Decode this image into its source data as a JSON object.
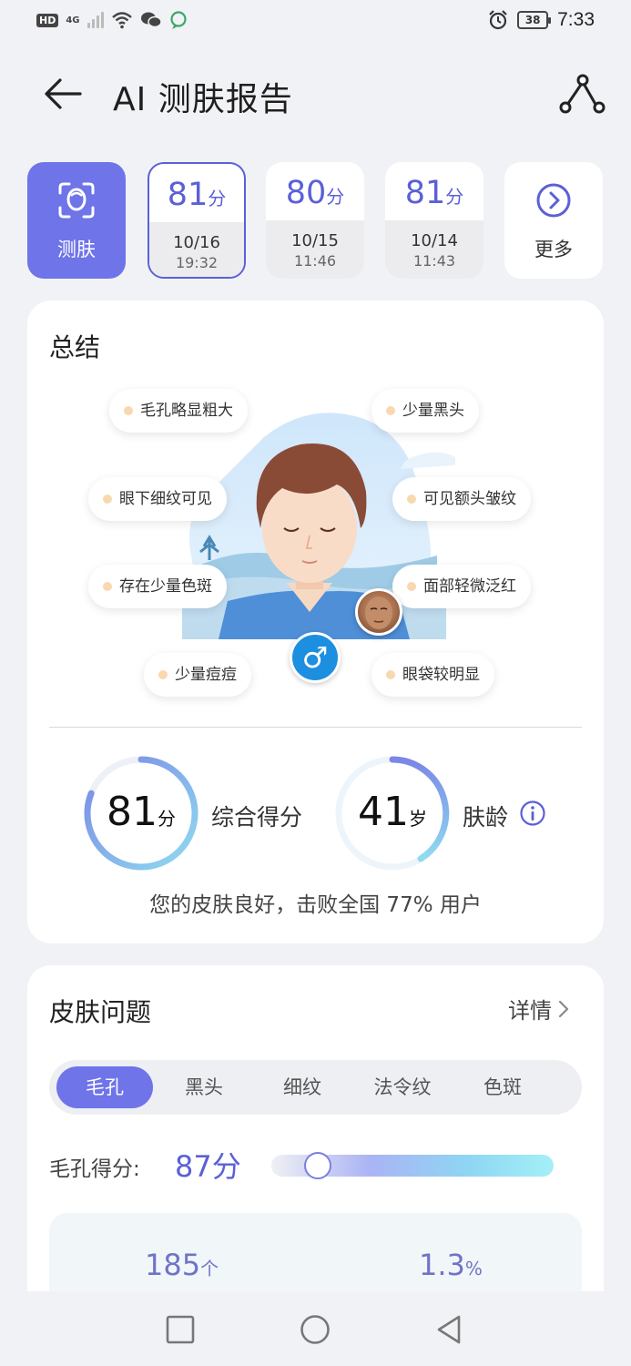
{
  "status_bar": {
    "left_badge": "HD",
    "network": "4G",
    "battery": "38",
    "time": "7:33"
  },
  "header": {
    "title": "AI 测肤报告"
  },
  "history": {
    "scan_label": "测肤",
    "records": [
      {
        "score": "81",
        "unit": "分",
        "date": "10/16",
        "time": "19:32"
      },
      {
        "score": "80",
        "unit": "分",
        "date": "10/15",
        "time": "11:46"
      },
      {
        "score": "81",
        "unit": "分",
        "date": "10/14",
        "time": "11:43"
      }
    ],
    "more_label": "更多"
  },
  "summary": {
    "title": "总结",
    "tags": [
      "毛孔略显粗大",
      "少量黑头",
      "眼下细纹可见",
      "可见额头皱纹",
      "存在少量色斑",
      "面部轻微泛红",
      "少量痘痘",
      "眼袋较明显"
    ],
    "gender_symbol": "♂",
    "overall": {
      "value": "81",
      "unit": "分",
      "label": "综合得分",
      "fraction": 0.81
    },
    "skin_age": {
      "value": "41",
      "unit": "岁",
      "label": "肤龄"
    },
    "beat_text": "您的皮肤良好，击败全国 77% 用户"
  },
  "issues": {
    "title": "皮肤问题",
    "detail_label": "详情",
    "tabs": [
      "毛孔",
      "黑头",
      "细纹",
      "法令纹",
      "色斑"
    ],
    "active_tab": "毛孔",
    "score_label": "毛孔得分:",
    "score_value": "87分",
    "score_fraction": 0.87,
    "stats": [
      {
        "value": "185",
        "unit": "个"
      },
      {
        "value": "1.3",
        "unit": "%"
      }
    ]
  },
  "colors": {
    "accent": "#6f74e8",
    "accent_text": "#5b60d6",
    "male_badge": "#1d8fe0"
  },
  "icons": {
    "back": "back-arrow-icon",
    "share": "share-icon",
    "scan": "face-scan-icon",
    "more": "chevron-right-circle-icon",
    "info": "info-icon",
    "nav_recent": "square-icon",
    "nav_home": "circle-icon",
    "nav_back": "triangle-back-icon"
  }
}
